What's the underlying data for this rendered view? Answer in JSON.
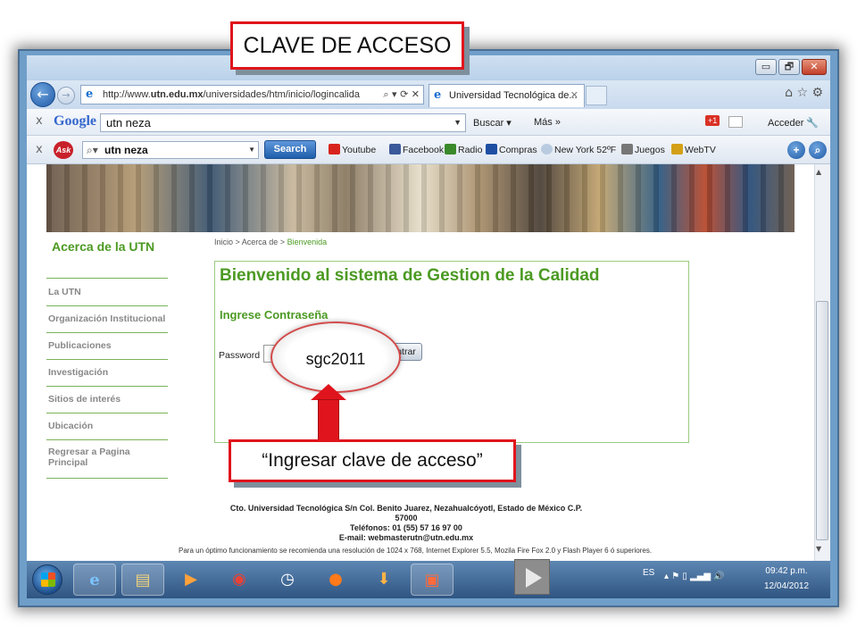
{
  "slide": {
    "title": "CLAVE DE ACCESO",
    "hint": "“Ingresar clave de acceso”",
    "password_value": "sgc2011"
  },
  "window": {
    "minimize": "▭",
    "restore": "🗗",
    "close": "✕"
  },
  "browser": {
    "url_domain": "utn.edu.mx",
    "url_prefix": "http://www.",
    "url_suffix": "/universidades/htm/inicio/logincalida",
    "tab_label": "Universidad Tecnológica de...",
    "nav_icons": "⌂ ☆ ⚙"
  },
  "google_toolbar": {
    "logo": "Google",
    "query": "utn neza",
    "buscar": "Buscar ▾",
    "mas": "Más »",
    "plus": "+1",
    "acceder": "Acceder 🔧"
  },
  "ask_toolbar": {
    "logo": "Ask",
    "query": "utn neza",
    "search_button": "Search",
    "items": [
      "Youtube",
      "Facebook",
      "Radio",
      "Compras",
      "New York 52ºF",
      "Juegos",
      "WebTV"
    ]
  },
  "page": {
    "sidebar_title": "Acerca de la UTN",
    "sidebar_items": [
      "La UTN",
      "Organización Institucional",
      "Publicaciones",
      "Investigación",
      "Sitios de interés",
      "Ubicación",
      "Regresar a Pagina Principal"
    ],
    "breadcrumb_prefix": "Inicio > Acerca de > ",
    "breadcrumb_current": "Bienvenida",
    "welcome": "Bienvenido al sistema de Gestion de la Calidad",
    "subtitle": "Ingrese Contraseña",
    "password_label": "Password",
    "submit": "Entrar",
    "footer_line1": "Cto. Universidad Tecnológica S/n Col. Benito Juarez, Nezahualcóyotl, Estado de México C.P. 57000",
    "footer_line2": "Teléfonos: 01 (55) 57 16 97 00",
    "footer_line3": "E-mail: webmasterutn@utn.edu.mx",
    "note": "Para un óptimo funcionamiento se recomienda una resolución de 1024 x 768, Internet Explorer 5.5, Mozila Fire Fox 2.0 y Flash Player 6 ó superiores."
  },
  "taskbar": {
    "lang": "ES",
    "time": "09:42 p.m.",
    "date": "12/04/2012"
  }
}
